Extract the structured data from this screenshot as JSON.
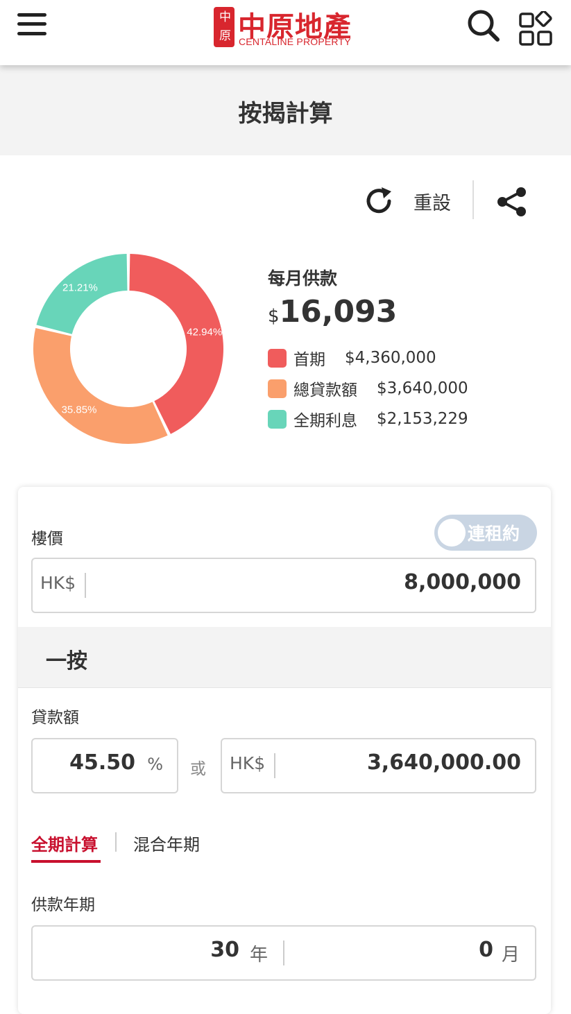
{
  "header": {
    "logo_seal": "中原",
    "logo_cn": "中原地產",
    "logo_en": "CENTALINE PROPERTY"
  },
  "page": {
    "title": "按揭計算"
  },
  "toolbar": {
    "reset_label": "重設"
  },
  "summary": {
    "monthly_label": "每月供款",
    "currency_symbol": "$",
    "monthly_value": "16,093",
    "legend": [
      {
        "name": "首期",
        "value": "$4,360,000",
        "color": "#f05c5c"
      },
      {
        "name": "總貸款額",
        "value": "$3,640,000",
        "color": "#fa9f6c"
      },
      {
        "name": "全期利息",
        "value": "$2,153,229",
        "color": "#68d5b9"
      }
    ]
  },
  "chart_data": {
    "type": "pie",
    "labels": [
      "首期",
      "總貸款額",
      "全期利息"
    ],
    "values": [
      42.94,
      35.85,
      21.21
    ],
    "value_labels": [
      "42.94%",
      "35.85%",
      "21.21%"
    ],
    "colors": [
      "#f05c5c",
      "#fa9f6c",
      "#68d5b9"
    ]
  },
  "form": {
    "property_price_label": "樓價",
    "tenancy_toggle_label": "連租約",
    "tenancy_toggle_on": false,
    "currency_prefix": "HK$",
    "property_price_value": "8,000,000",
    "first_mortgage_title": "一按",
    "loan_amount_label": "貸款額",
    "loan_percent_value": "45.50",
    "percent_sign": "%",
    "or_text": "或",
    "loan_amount_value": "3,640,000.00",
    "tabs": [
      {
        "label": "全期計算",
        "active": true
      },
      {
        "label": "混合年期",
        "active": false
      }
    ],
    "term_label": "供款年期",
    "term_years": "30",
    "years_unit": "年",
    "term_months": "0",
    "months_unit": "月"
  }
}
